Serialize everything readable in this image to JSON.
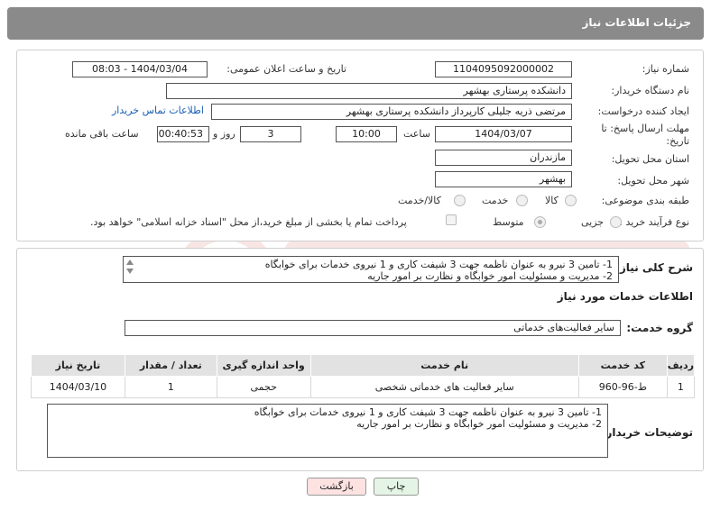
{
  "header": {
    "title": "جزئیات اطلاعات نیاز"
  },
  "form": {
    "need_number_label": "شماره نیاز:",
    "need_number": "1104095092000002",
    "announce_label": "تاریخ و ساعت اعلان عمومی:",
    "announce_value": "1404/03/04 - 08:03",
    "buyer_org_label": "نام دستگاه خریدار:",
    "buyer_org": "دانشکده پرستاری بهشهر",
    "creator_label": "ایجاد کننده درخواست:",
    "creator": "مرتضی ذریه جلیلی کارپرداز دانشکده پرستاری بهشهر",
    "contact_link": "اطلاعات تماس خریدار",
    "deadline_label": "مهلت ارسال پاسخ: تا تاریخ:",
    "deadline_date": "1404/03/07",
    "time_label": "ساعت",
    "deadline_time": "10:00",
    "days_value": "3",
    "days_label": "روز و",
    "remaining_time": "00:40:53",
    "remaining_label": "ساعت باقی مانده",
    "province_label": "استان محل تحویل:",
    "province": "مازندران",
    "city_label": "شهر محل تحویل:",
    "city": "بهشهر",
    "category_label": "طبقه بندی موضوعی:",
    "category_options": [
      "کالا",
      "خدمت",
      "کالا/خدمت"
    ],
    "process_label": "نوع فرآیند خرید :",
    "process_options": [
      "جزیی",
      "متوسط"
    ],
    "payment_note": "پرداخت تمام یا بخشی از مبلغ خرید،از محل \"اسناد خزانه اسلامی\" خواهد بود."
  },
  "summary": {
    "label": "شرح کلی نیاز:",
    "lines": [
      "1-    تامین 3 نیرو به عنوان ناظمه جهت 3 شیفت کاری و 1 نیروی خدمات برای خوابگاه",
      "2-    مدیریت و مسئولیت امور خوابگاه و نظارت بر امور جاریه"
    ]
  },
  "services": {
    "section_title": "اطلاعات خدمات مورد نیاز",
    "group_label": "گروه خدمت:",
    "group_value": "سایر فعالیت‌های خدماتی",
    "columns": [
      "ردیف",
      "کد خدمت",
      "نام خدمت",
      "واحد اندازه گیری",
      "تعداد / مقدار",
      "تاریخ نیاز"
    ],
    "rows": [
      [
        "1",
        "ط-96-960",
        "سایر فعالیت های خدماتی شخصی",
        "حجمی",
        "1",
        "1404/03/10"
      ]
    ]
  },
  "buyer_notes": {
    "label": "توضیحات خریدار:",
    "lines": [
      "1-    تامین 3 نیرو به عنوان ناظمه جهت 3 شیفت کاری و 1 نیروی خدمات برای خوابگاه",
      "2-    مدیریت و مسئولیت امور خوابگاه و نظارت بر امور جاریه"
    ]
  },
  "buttons": {
    "print": "چاپ",
    "back": "بازگشت"
  },
  "colors": {
    "header_bg": "#8a8a8a",
    "link": "#1a5fb4",
    "back_btn_bg": "#fde2e2",
    "print_btn_bg": "#e5f5e5"
  }
}
